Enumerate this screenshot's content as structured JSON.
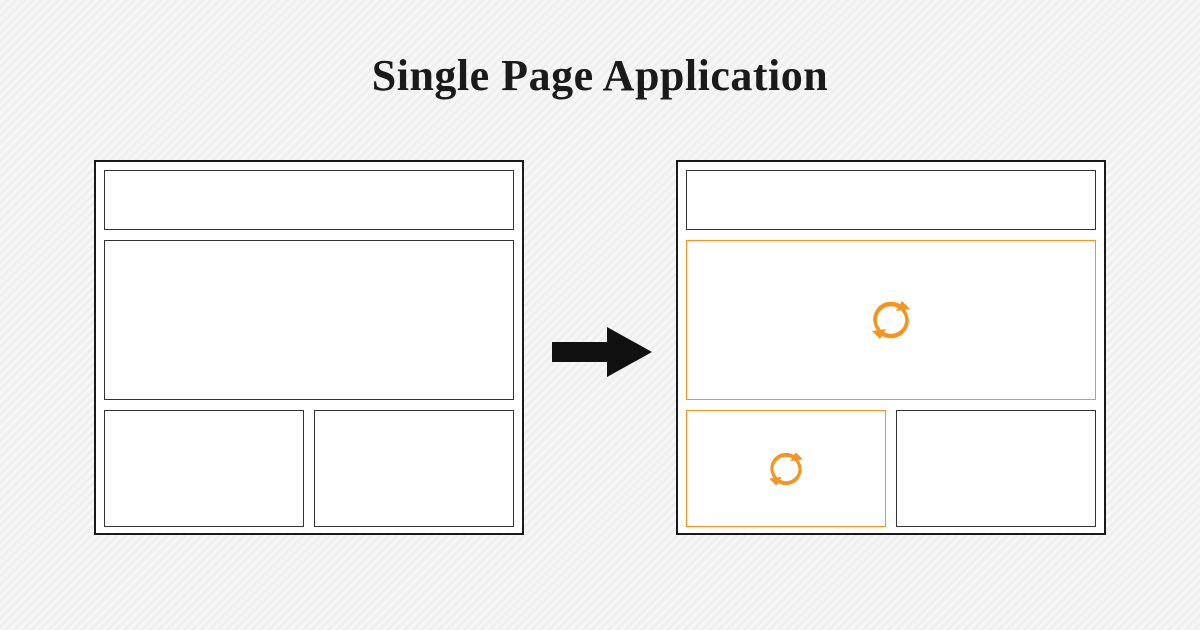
{
  "title": "Single Page Application",
  "colors": {
    "accent": "#f7941d",
    "ink": "#1a1a1a"
  },
  "diagram": {
    "left_frame": {
      "description": "initial page wireframe",
      "regions": [
        "header",
        "hero",
        "bottom-left",
        "bottom-right"
      ]
    },
    "right_frame": {
      "description": "after navigation — only some regions reload",
      "regions": [
        "header",
        "hero",
        "bottom-left",
        "bottom-right"
      ],
      "reloaded": [
        "hero",
        "bottom-left"
      ]
    },
    "arrow": "navigate"
  }
}
